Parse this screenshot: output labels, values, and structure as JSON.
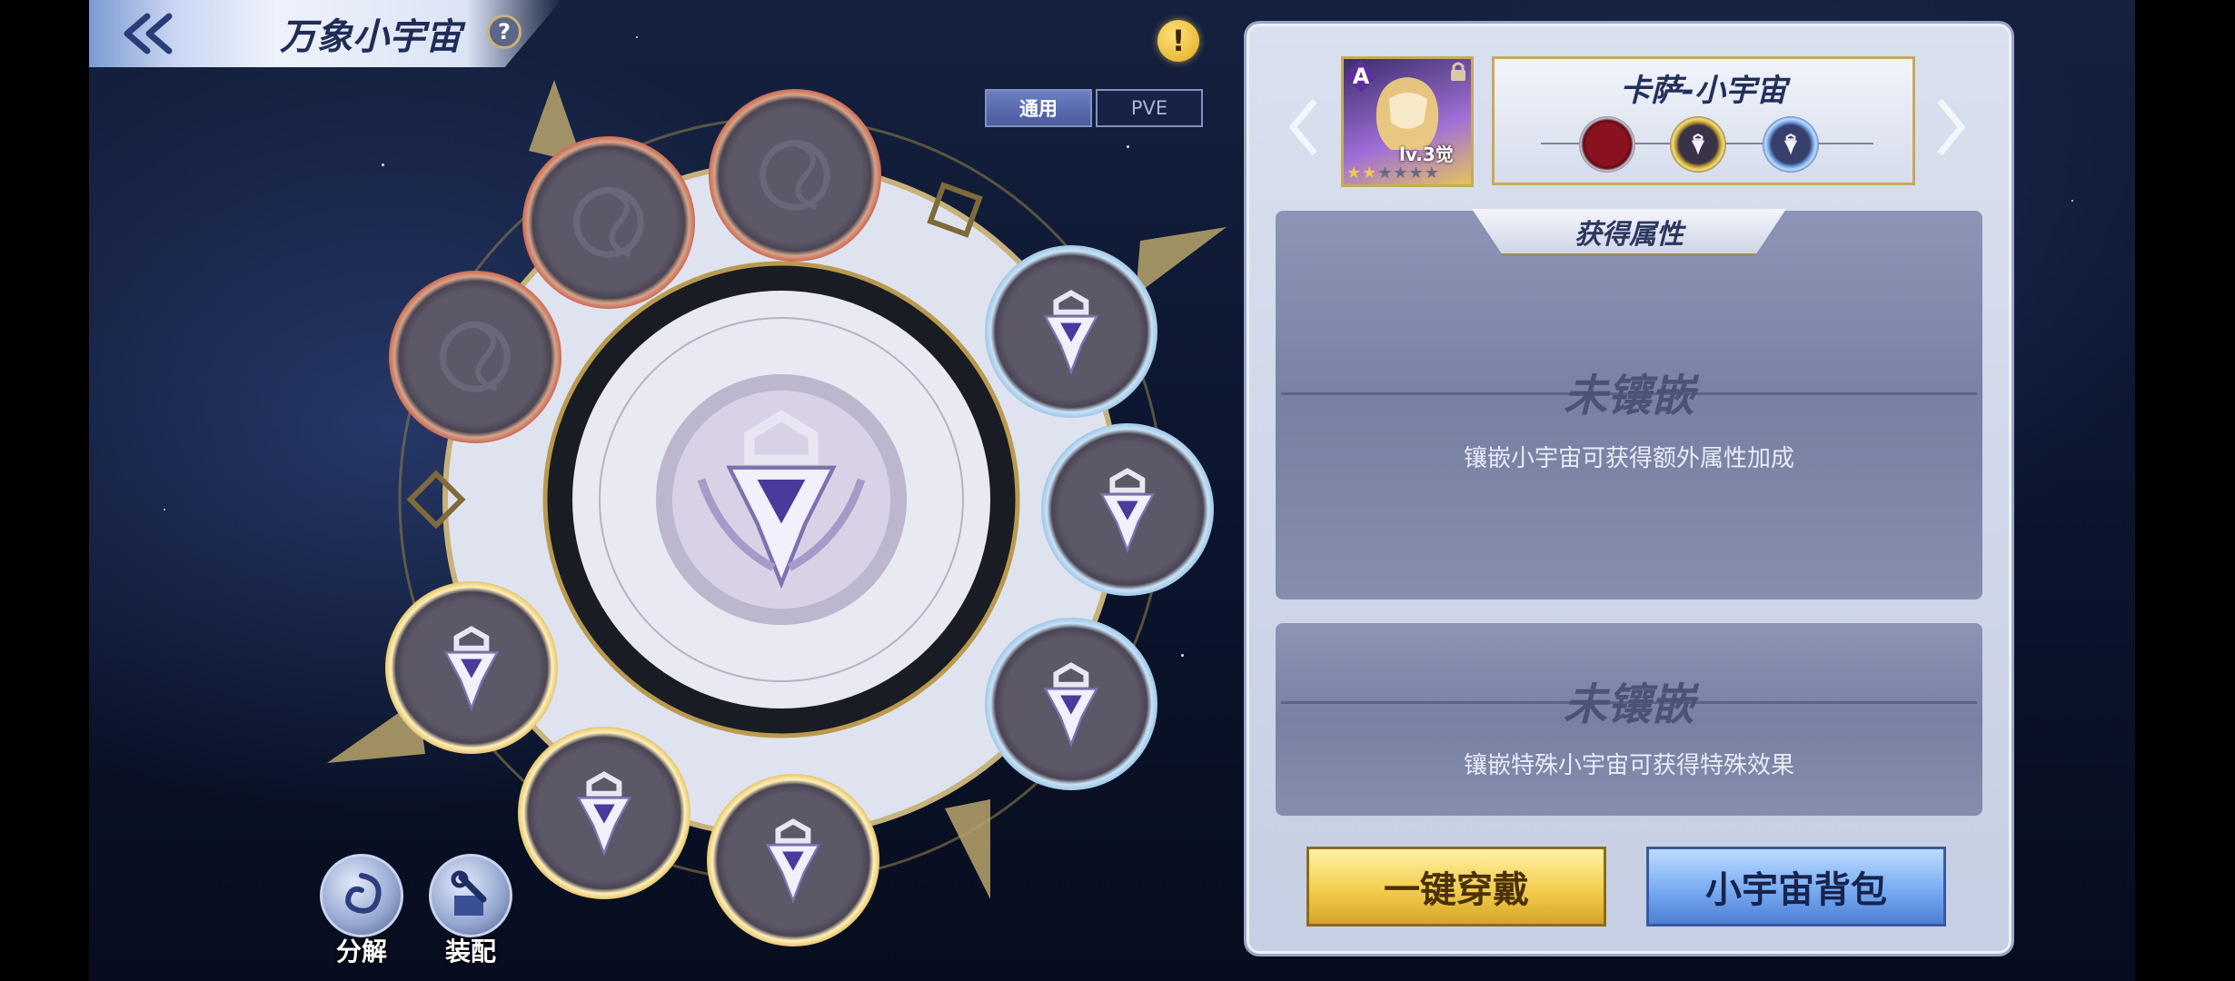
{
  "header": {
    "title": "万象小宇宙",
    "back_icon": "double-chevron-left-icon",
    "help_glyph": "?"
  },
  "alert": {
    "glyph": "!"
  },
  "tabs": [
    {
      "label": "通用",
      "active": true
    },
    {
      "label": "PVE",
      "active": false
    }
  ],
  "wheel": {
    "slots": [
      {
        "id": "top-left-1",
        "ring": "red",
        "filled": false
      },
      {
        "id": "top-left-2",
        "ring": "red",
        "filled": false
      },
      {
        "id": "left",
        "ring": "red",
        "filled": false
      },
      {
        "id": "right-1",
        "ring": "blue",
        "filled": true
      },
      {
        "id": "right-2",
        "ring": "blue",
        "filled": true
      },
      {
        "id": "right-3",
        "ring": "blue",
        "filled": true
      },
      {
        "id": "bottom-left-1",
        "ring": "gold",
        "filled": true
      },
      {
        "id": "bottom-left-2",
        "ring": "gold",
        "filled": true
      },
      {
        "id": "bottom",
        "ring": "gold",
        "filled": true
      }
    ]
  },
  "actions": {
    "decompose": {
      "label": "分解",
      "icon": "swirl-icon"
    },
    "assemble": {
      "label": "装配",
      "icon": "wrench-box-icon"
    }
  },
  "hero": {
    "rank": "A",
    "level": "lv.3觉",
    "stars_filled": 2,
    "stars_total": 6
  },
  "cosmo": {
    "name": "卡萨-小宇宙",
    "slot_colors": {
      "red": "#8a1220",
      "gold": "#bc9a2c",
      "blue": "#6e9ce0"
    }
  },
  "attributes": {
    "header": "获得属性",
    "primary": {
      "title": "未镶嵌",
      "desc": "镶嵌小宇宙可获得额外属性加成"
    },
    "special": {
      "title": "未镶嵌",
      "desc": "镶嵌特殊小宇宙可获得特殊效果"
    }
  },
  "buttons": {
    "equip": "一键穿戴",
    "bag": "小宇宙背包"
  },
  "colors": {
    "accent_gold": "#d5a626",
    "accent_blue": "#4d7fd4",
    "panel": "#c6cfe3"
  }
}
